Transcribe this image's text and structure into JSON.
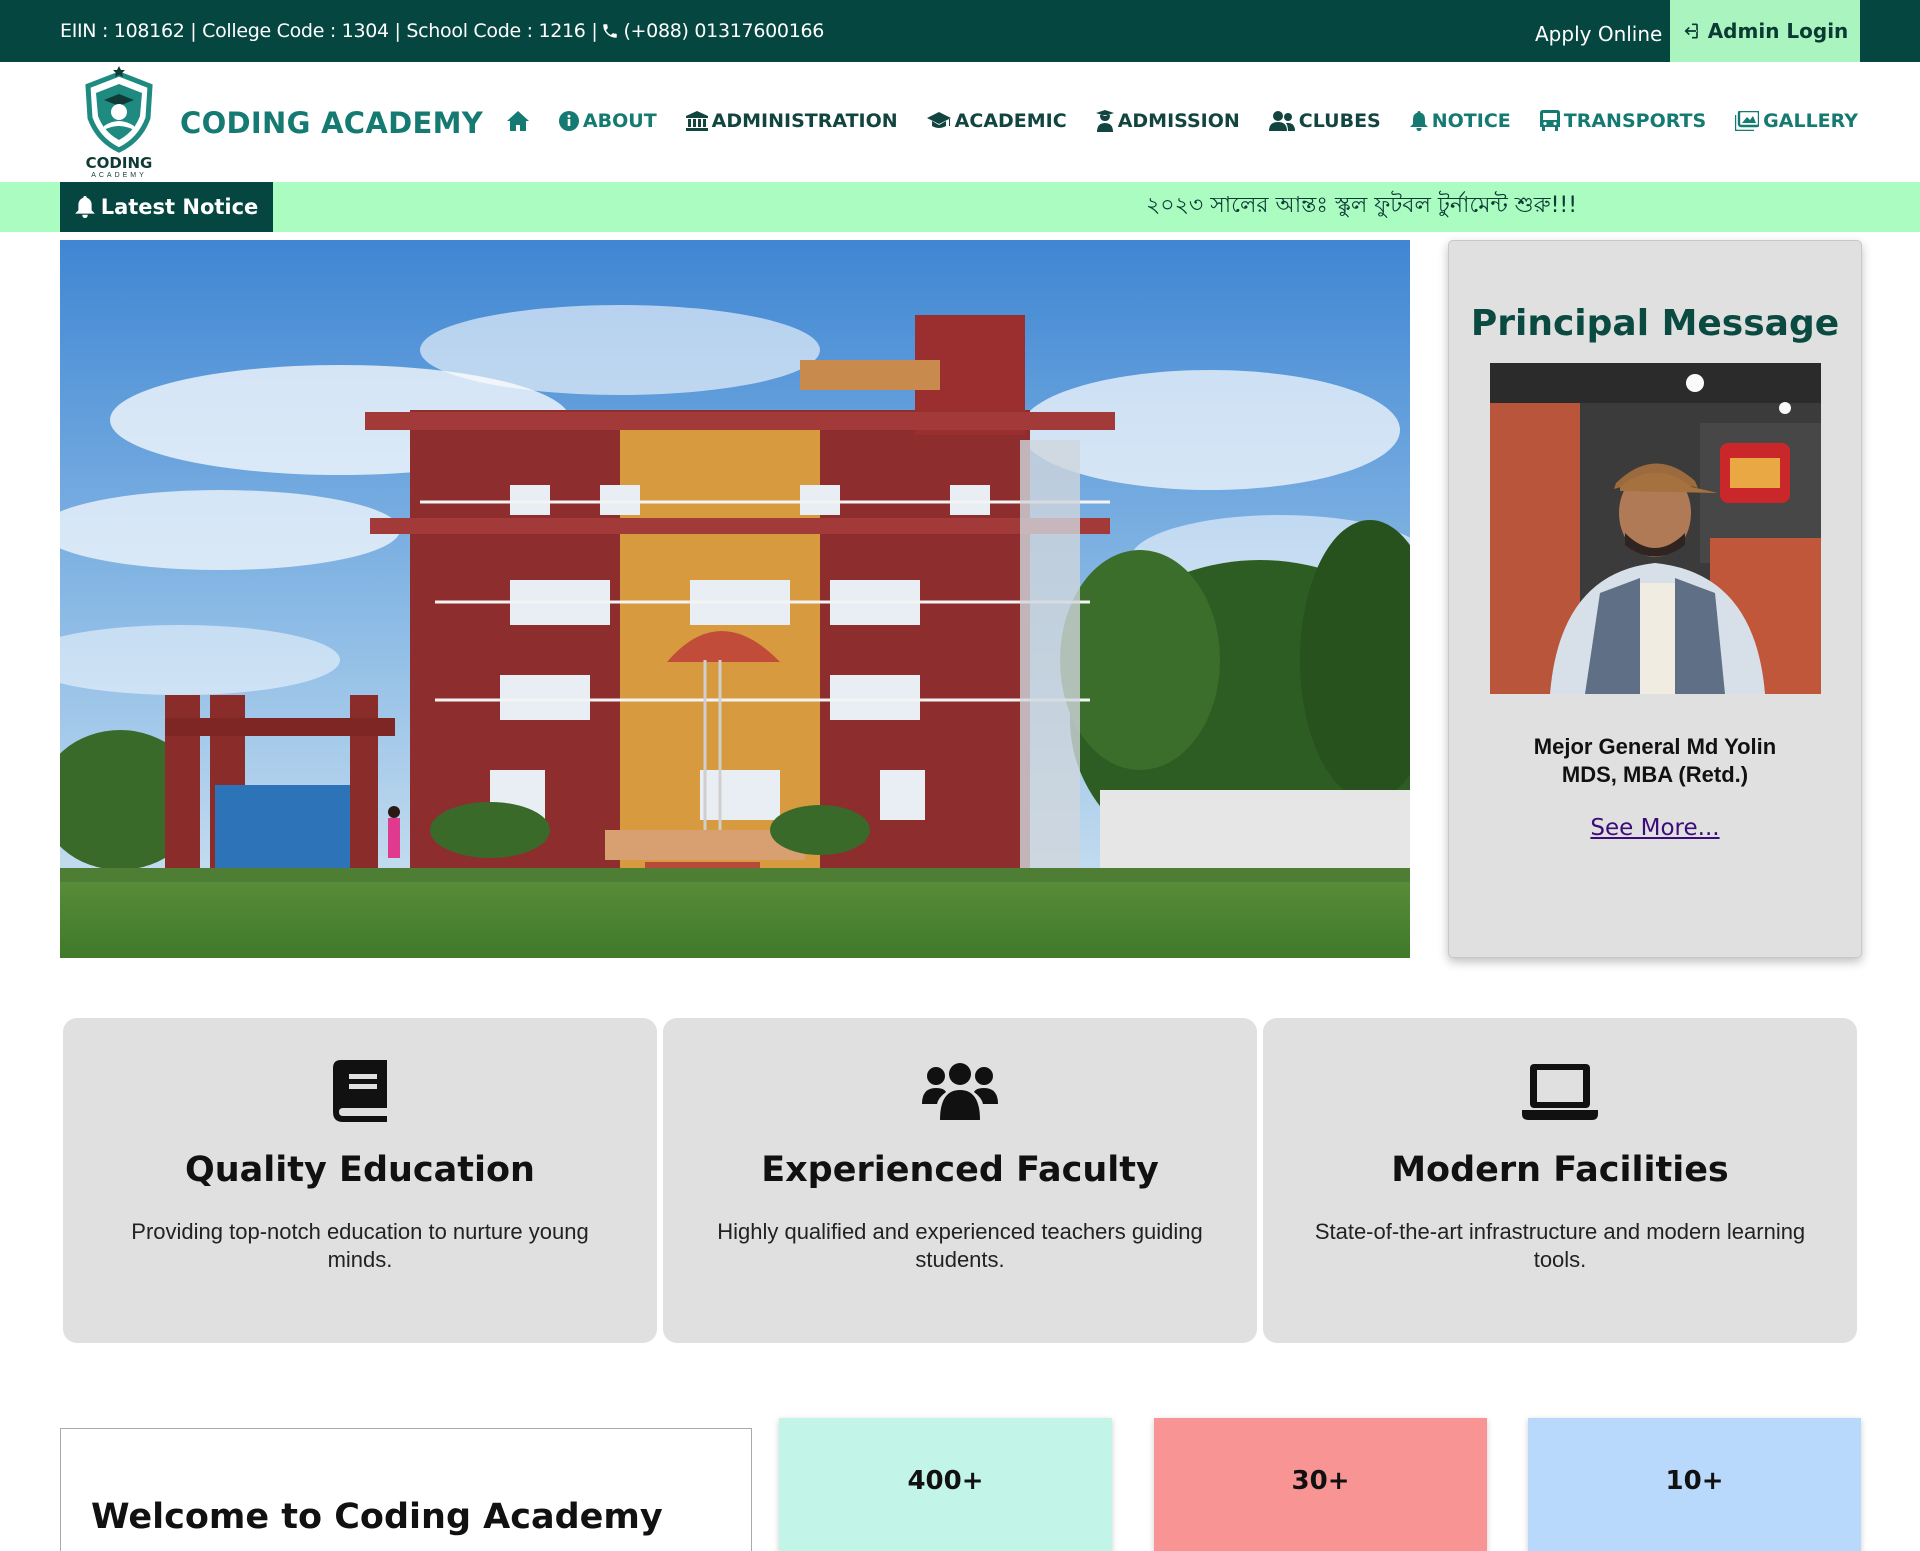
{
  "topbar": {
    "info": "EIIN : 108162 | College Code : 1304 | School Code : 1216 |",
    "phone": "(+088) 01317600166",
    "apply_online": "Apply Online",
    "admin_login": "Admin Login"
  },
  "header": {
    "logo_text": "CODING",
    "logo_subtext": "ACADEMY",
    "brand": "CODING ACADEMY",
    "nav": [
      {
        "label": "",
        "icon": "home-icon"
      },
      {
        "label": "ABOUT",
        "icon": "info-icon"
      },
      {
        "label": "ADMINISTRATION",
        "icon": "building-columns-icon"
      },
      {
        "label": "ACADEMIC",
        "icon": "graduation-cap-icon"
      },
      {
        "label": "ADMISSION",
        "icon": "user-graduate-icon"
      },
      {
        "label": "CLUBES",
        "icon": "users-icon"
      },
      {
        "label": "NOTICE",
        "icon": "bell-icon"
      },
      {
        "label": "TRANSPORTS",
        "icon": "bus-icon"
      },
      {
        "label": "GALLERY",
        "icon": "images-icon"
      }
    ]
  },
  "notice": {
    "tag": "Latest Notice",
    "text": "২০২৩ সালের আন্তঃ স্কুল ফুটবল টুর্নামেন্ট শুরু!!!"
  },
  "principal": {
    "title": "Principal Message",
    "name_line1": "Mejor General Md Yolin",
    "name_line2": "MDS, MBA (Retd.)",
    "see_more": "See More..."
  },
  "features": [
    {
      "icon": "book-icon",
      "title": "Quality Education",
      "text": "Providing top-notch education to nurture young minds."
    },
    {
      "icon": "users-icon",
      "title": "Experienced Faculty",
      "text": "Highly qualified and experienced teachers guiding students."
    },
    {
      "icon": "laptop-icon",
      "title": "Modern Facilities",
      "text": "State-of-the-art infrastructure and modern learning tools."
    }
  ],
  "welcome": {
    "title": "Welcome to Coding Academy"
  },
  "stats": [
    {
      "value": "400+",
      "color": "#c2f5e8"
    },
    {
      "value": "30+",
      "color": "#f89494"
    },
    {
      "value": "10+",
      "color": "#b8d9fb"
    }
  ],
  "colors": {
    "dark_green": "#054740",
    "teal": "#157a72",
    "mint": "#aafcc0",
    "card_gray": "#e0e0e0"
  }
}
